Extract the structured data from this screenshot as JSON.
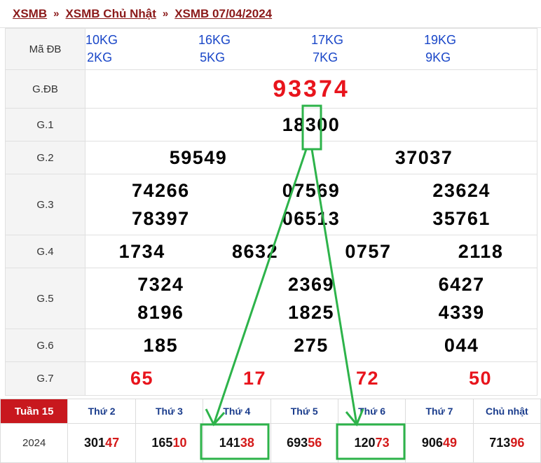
{
  "breadcrumb": {
    "item1": "XSMB",
    "item2": "XSMB Chủ Nhật",
    "item3": "XSMB 07/04/2024",
    "sep": "»"
  },
  "results": {
    "ma_db_label": "Mã ĐB",
    "ma_db_codes": [
      [
        "10KG",
        "2KG"
      ],
      [
        "16KG",
        "5KG"
      ],
      [
        "17KG",
        "7KG"
      ],
      [
        "19KG",
        "9KG"
      ]
    ],
    "gdb_label": "G.ĐB",
    "gdb": "93374",
    "g1_label": "G.1",
    "g1": "18300",
    "g2_label": "G.2",
    "g2": [
      "59549",
      "37037"
    ],
    "g3_label": "G.3",
    "g3": [
      [
        "74266",
        "07569",
        "23624"
      ],
      [
        "78397",
        "06513",
        "35761"
      ]
    ],
    "g4_label": "G.4",
    "g4": [
      "1734",
      "8632",
      "0757",
      "2118"
    ],
    "g5_label": "G.5",
    "g5": [
      [
        "7324",
        "2369",
        "6427"
      ],
      [
        "8196",
        "1825",
        "4339"
      ]
    ],
    "g6_label": "G.6",
    "g6": [
      "185",
      "275",
      "044"
    ],
    "g7_label": "G.7",
    "g7": [
      "65",
      "17",
      "72",
      "50"
    ]
  },
  "weekly": {
    "week_label": "Tuần 15",
    "year": "2024",
    "days": [
      "Thứ 2",
      "Thứ 3",
      "Thứ 4",
      "Thứ 5",
      "Thứ 6",
      "Thứ 7",
      "Chủ nhật"
    ],
    "values": [
      {
        "head": "301",
        "tail": "47"
      },
      {
        "head": "165",
        "tail": "10"
      },
      {
        "head": "141",
        "tail": "38"
      },
      {
        "head": "693",
        "tail": "56"
      },
      {
        "head": "120",
        "tail": "73"
      },
      {
        "head": "906",
        "tail": "49"
      },
      {
        "head": "713",
        "tail": "96"
      }
    ]
  },
  "colors": {
    "breadcrumb": "#8b1a1a",
    "special_prize": "#e8141c",
    "code_blue": "#1a47c8",
    "annotation_green": "#2db34a"
  }
}
